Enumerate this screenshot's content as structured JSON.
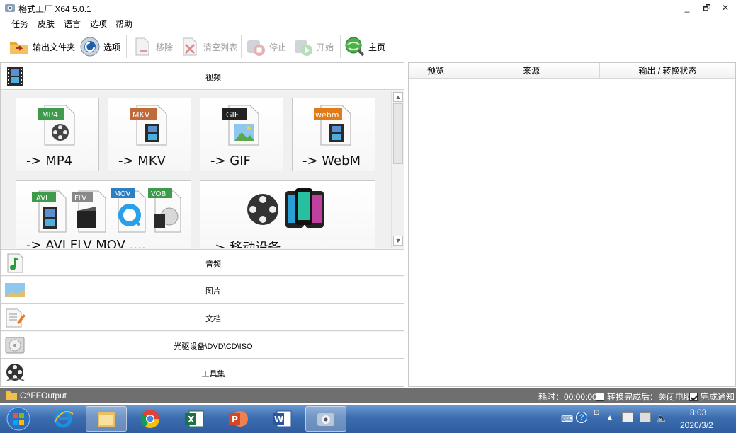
{
  "window": {
    "title": "格式工厂 X64 5.0.1",
    "minimize": "_",
    "restore": "🗗",
    "close": "✕"
  },
  "menu": [
    "任务",
    "皮肤",
    "语言",
    "选项",
    "帮助"
  ],
  "toolbar": {
    "output_folder": "输出文件夹",
    "options": "选项",
    "remove": "移除",
    "clear_list": "清空列表",
    "stop": "停止",
    "start": "开始",
    "home": "主页"
  },
  "categories": {
    "video": "视频",
    "audio": "音频",
    "image": "图片",
    "document": "文档",
    "disc": "光驱设备\\DVD\\CD\\ISO",
    "tools": "工具集"
  },
  "video_tiles": [
    {
      "label": "-> MP4",
      "badge": "MP4",
      "badge_color": "#3f9a4b"
    },
    {
      "label": "-> MKV",
      "badge": "MKV",
      "badge_color": "#c06a3a"
    },
    {
      "label": "-> GIF",
      "badge": "GIF",
      "badge_color": "#222222"
    },
    {
      "label": "-> WebM",
      "badge": "webm",
      "badge_color": "#e07b1a"
    },
    {
      "label": "-> AVI FLV MOV ....",
      "badges": [
        "AVI",
        "FLV",
        "MOV",
        "VOB"
      ]
    },
    {
      "label": "-> 移动设备"
    }
  ],
  "task_list": {
    "columns": [
      "预览",
      "来源",
      "输出 / 转换状态"
    ]
  },
  "status": {
    "output_path": "C:\\FFOutput",
    "elapsed": "耗时：00:00:00",
    "shutdown_option": "转换完成后：关闭电脑",
    "notify_option": "完成通知",
    "shutdown_checked": false,
    "notify_checked": true
  },
  "taskbar": {
    "time": "8:03",
    "date": "2020/3/2"
  },
  "colors": {
    "statusbar": "#6f6f6f",
    "taskbar": "#3c6db0",
    "accent_green": "#3f9a4b"
  }
}
